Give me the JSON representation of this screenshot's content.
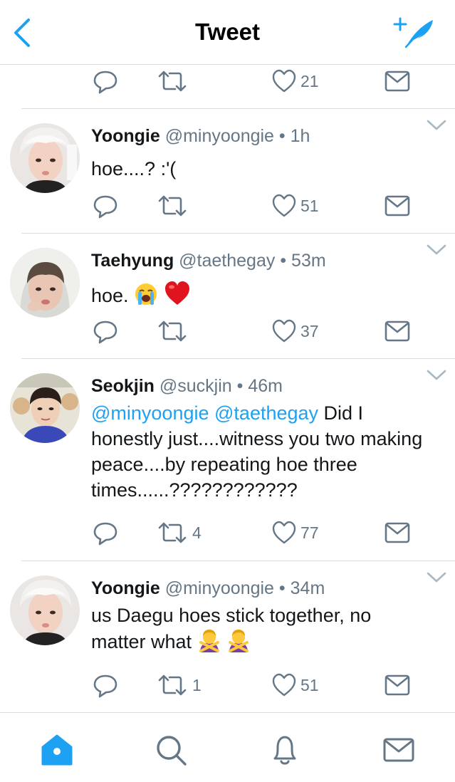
{
  "header": {
    "title": "Tweet"
  },
  "top_partial": {
    "likes": "21"
  },
  "tweets": [
    {
      "name": "Yoongie",
      "handle": "@minyoongie",
      "dot": "•",
      "time": "1h",
      "text": "hoe....? :'(",
      "retweets": "",
      "likes": "51"
    },
    {
      "name": "Taehyung",
      "handle": "@taethegay",
      "dot": "•",
      "time": "53m",
      "text": "hoe.",
      "retweets": "",
      "likes": "37"
    },
    {
      "name": "Seokjin",
      "handle": "@suckjin",
      "dot": "•",
      "time": "46m",
      "mention1": "@minyoongie",
      "mention2": "@taethegay",
      "text": "Did I honestly just....witness you two making peace....by repeating hoe three times......????????????",
      "retweets": "4",
      "likes": "77"
    },
    {
      "name": "Yoongie",
      "handle": "@minyoongie",
      "dot": "•",
      "time": "34m",
      "text": "us Daegu hoes stick together, no matter what",
      "retweets": "1",
      "likes": "51"
    }
  ],
  "colors": {
    "accent": "#1da1f2",
    "muted": "#657786",
    "divider": "#d8dde2",
    "text": "#14171a"
  },
  "icons": [
    "back-chevron-icon",
    "compose-tweet-icon",
    "reply-icon",
    "retweet-icon",
    "like-heart-icon",
    "direct-message-icon",
    "home-icon",
    "search-icon",
    "notifications-icon",
    "messages-icon",
    "menu-caret-icon"
  ]
}
